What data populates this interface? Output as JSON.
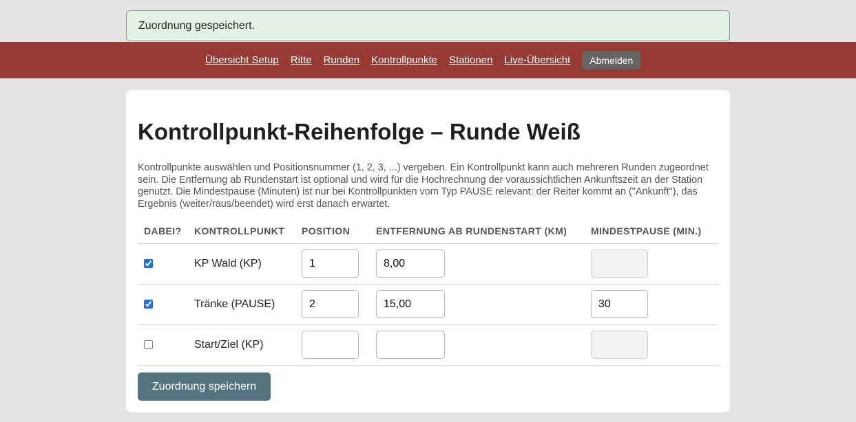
{
  "flash": {
    "message": "Zuordnung gespeichert."
  },
  "nav": {
    "links": [
      "Übersicht Setup",
      "Ritte",
      "Runden",
      "Kontrollpunkte",
      "Stationen",
      "Live-Übersicht"
    ],
    "logout_label": "Abmelden"
  },
  "page": {
    "title": "Kontrollpunkt-Reihenfolge – Runde Weiß",
    "intro": "Kontrollpunkte auswählen und Positionsnummer (1, 2, 3, ...) vergeben. Ein Kontrollpunkt kann auch mehreren Runden zugeordnet sein. Die Entfernung ab Rundenstart ist optional und wird für die Hochrechnung der voraussichtlichen Ankunftszeit an der Station genutzt. Die Mindestpause (Minuten) ist nur bei Kontrollpunkten vom Typ PAUSE relevant: der Reiter kommt an (\"Ankunft\"), das Ergebnis (weiter/raus/beendet) wird erst danach erwartet."
  },
  "table": {
    "headers": [
      "Dabei?",
      "Kontrollpunkt",
      "Position",
      "Entfernung ab Rundenstart (km)",
      "Mindestpause (min.)"
    ],
    "rows": [
      {
        "checked": true,
        "name": "KP Wald (KP)",
        "position": "1",
        "distance": "8,00",
        "pause": "",
        "pause_enabled": false
      },
      {
        "checked": true,
        "name": "Tränke (PAUSE)",
        "position": "2",
        "distance": "15,00",
        "pause": "30",
        "pause_enabled": true
      },
      {
        "checked": false,
        "name": "Start/Ziel (KP)",
        "position": "",
        "distance": "",
        "pause": "",
        "pause_enabled": false
      }
    ]
  },
  "save_label": "Zuordnung speichern",
  "colors": {
    "nav_background": "#973a34",
    "save_button": "#55737f",
    "flash_background": "#e3f2e5",
    "logout_button": "#646464"
  }
}
